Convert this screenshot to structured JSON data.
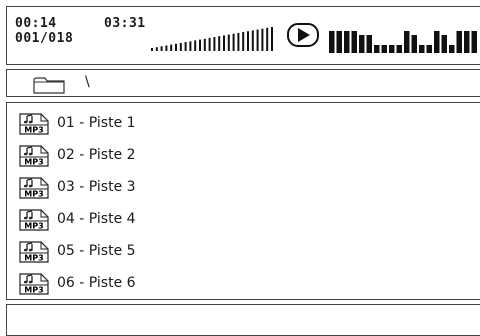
{
  "status": {
    "elapsed": "00:14",
    "total": "03:31",
    "track_counter": "001/018",
    "volume_level": 1.0,
    "play_icon": "play-icon",
    "spectrum_levels": [
      0.55,
      0.55,
      0.55,
      0.55,
      0.45,
      0.45,
      0.2,
      0.2,
      0.2,
      0.2,
      0.55,
      0.45,
      0.2,
      0.2,
      0.55,
      0.45,
      0.2,
      0.55,
      0.55,
      0.55
    ]
  },
  "path": {
    "folder_icon": "folder-icon",
    "current": "\\"
  },
  "files": [
    {
      "icon": "mp3-file-icon",
      "icon_text": "MP3",
      "label": "01 - Piste 1"
    },
    {
      "icon": "mp3-file-icon",
      "icon_text": "MP3",
      "label": "02 - Piste 2"
    },
    {
      "icon": "mp3-file-icon",
      "icon_text": "MP3",
      "label": "03 - Piste 3"
    },
    {
      "icon": "mp3-file-icon",
      "icon_text": "MP3",
      "label": "04 - Piste 4"
    },
    {
      "icon": "mp3-file-icon",
      "icon_text": "MP3",
      "label": "05 - Piste 5"
    },
    {
      "icon": "mp3-file-icon",
      "icon_text": "MP3",
      "label": "06 - Piste 6"
    }
  ]
}
